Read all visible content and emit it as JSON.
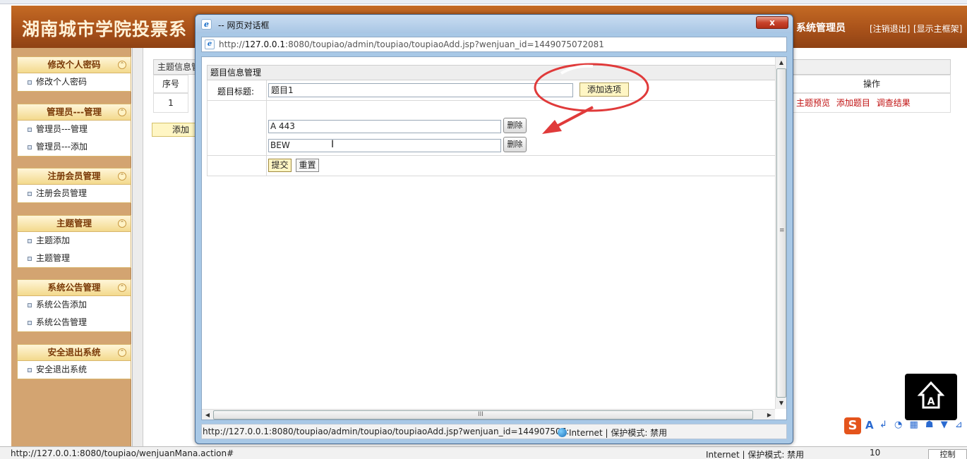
{
  "header": {
    "site_title": "湖南城市学院投票系",
    "admin_name": "系统管理员",
    "logout_link": "[注销退出]",
    "frame_link": "[显示主框架]"
  },
  "sidebar": {
    "sections": [
      {
        "title": "修改个人密码",
        "items": [
          "修改个人密码"
        ]
      },
      {
        "title": "管理员---管理",
        "items": [
          "管理员---管理",
          "管理员---添加"
        ]
      },
      {
        "title": "注册会员管理",
        "items": [
          "注册会员管理"
        ]
      },
      {
        "title": "主题管理",
        "items": [
          "主题添加",
          "主题管理"
        ]
      },
      {
        "title": "系统公告管理",
        "items": [
          "系统公告添加",
          "系统公告管理"
        ]
      },
      {
        "title": "安全退出系统",
        "items": [
          "安全退出系统"
        ]
      }
    ],
    "collapse_glyph": "⌃"
  },
  "main": {
    "head_bar": "主题信息管",
    "col_seq": "序号",
    "row_seq": "1",
    "col_op": "操作",
    "row_ops": [
      "主题预览",
      "添加题目",
      "调查结果"
    ],
    "add_button": "添加"
  },
  "dialog": {
    "title": "-- 网页对话框",
    "close_glyph": "x",
    "address_host": "127.0.0.1",
    "address_prefix": "http://",
    "address_suffix": ":8080/toupiao/admin/toupiao/toupiaoAdd.jsp?wenjuan_id=1449075072081",
    "status_url": "http://127.0.0.1:8080/toupiao/admin/toupiao/toupiaoAdd.jsp?wenjuan_id=144907507:",
    "status_zone": "Internet | 保护模式: 禁用",
    "form": {
      "header": "题目信息管理",
      "title_label": "题目标题:",
      "title_value": "题目1",
      "add_option": "添加选项",
      "options": [
        "A 443",
        "BEW"
      ],
      "delete_label": "删除",
      "submit": "提交",
      "reset": "重置"
    },
    "scroll": {
      "up": "▲",
      "down": "▼",
      "left": "◀",
      "right": "▶",
      "vgrip": "≡",
      "hgrip": "III"
    }
  },
  "statusbar": {
    "url": "http://127.0.0.1:8080/toupiao/wenjuanMana.action#",
    "zone": "Internet | 保护模式: 禁用",
    "zoom": "10",
    "ctrl": "控制"
  },
  "ime": {
    "logo": "S",
    "mode": "A",
    "icons": "↲ ◔ ▦ ☗ ▼ ⊿"
  },
  "colors": {
    "header": "#a9521a",
    "sidebar": "#d3a471",
    "highlight_button": "#fff6c4",
    "annotation_red": "#e03a3a",
    "link_red": "#c01010"
  }
}
